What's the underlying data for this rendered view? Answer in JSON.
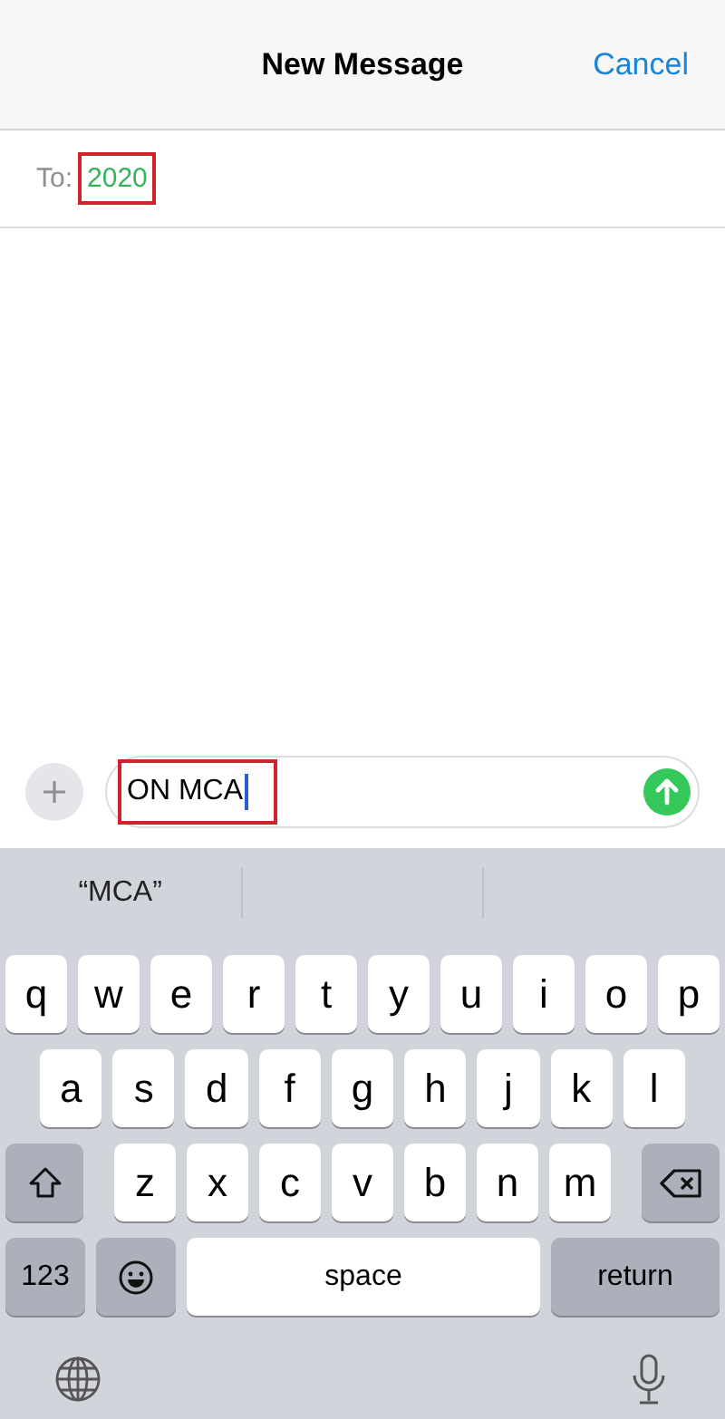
{
  "header": {
    "title": "New Message",
    "cancel": "Cancel"
  },
  "recipient": {
    "label": "To:",
    "value": "2020",
    "highlighted": true
  },
  "composer": {
    "text": "ON MCA",
    "highlighted": true
  },
  "suggestions": [
    "“MCA”"
  ],
  "keyboard": {
    "rows": [
      [
        "q",
        "w",
        "e",
        "r",
        "t",
        "y",
        "u",
        "i",
        "o",
        "p"
      ],
      [
        "a",
        "s",
        "d",
        "f",
        "g",
        "h",
        "j",
        "k",
        "l"
      ],
      [
        "z",
        "x",
        "c",
        "v",
        "b",
        "n",
        "m"
      ]
    ],
    "numbers": "123",
    "space": "space",
    "return": "return"
  }
}
